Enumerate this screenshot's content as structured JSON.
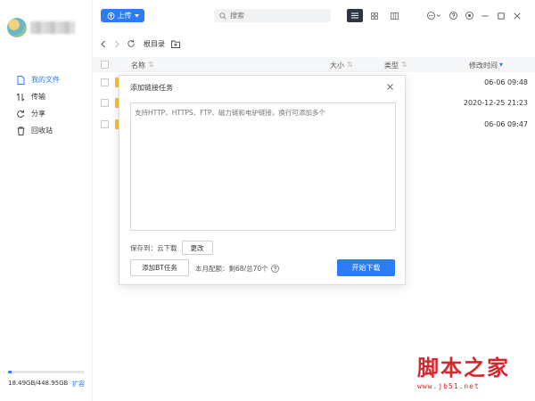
{
  "sidebar": {
    "items": [
      {
        "label": "我的文件",
        "icon": "file-icon",
        "active": true
      },
      {
        "label": "传输",
        "icon": "transfer-icon",
        "active": false
      },
      {
        "label": "分享",
        "icon": "share-icon",
        "active": false
      },
      {
        "label": "回收站",
        "icon": "trash-icon",
        "active": false
      }
    ],
    "storage": {
      "used_text": "18.49GB/448.95GB",
      "expand_label": "扩容",
      "used_fraction": 0.041
    }
  },
  "toolbar": {
    "upload_label": "上传",
    "search_placeholder": "搜索"
  },
  "pathbar": {
    "current": "根目录"
  },
  "table": {
    "headers": {
      "name": "名称",
      "size": "大小",
      "type": "类型",
      "modified": "修改时间"
    },
    "rows": [
      {
        "modified": "06-06 09:48"
      },
      {
        "modified": "2020-12-25 21:23"
      },
      {
        "modified": "06-06 09:47"
      }
    ]
  },
  "dialog": {
    "title": "添加链接任务",
    "textarea_placeholder": "支持HTTP、HTTPS、FTP、磁力链和电驴链接，换行可添加多个",
    "save_to": "保存到：云下载",
    "change_label": "更改",
    "bt_label": "添加BT任务",
    "quota_text": "本月配额：剩68/总70个",
    "start_label": "开始下载"
  },
  "watermark": {
    "main": "脚本之家",
    "sub": "www.jb51.net"
  },
  "colors": {
    "accent": "#2b7cf6",
    "folder": "#f8bf3c",
    "watermark": "#d9262c"
  }
}
